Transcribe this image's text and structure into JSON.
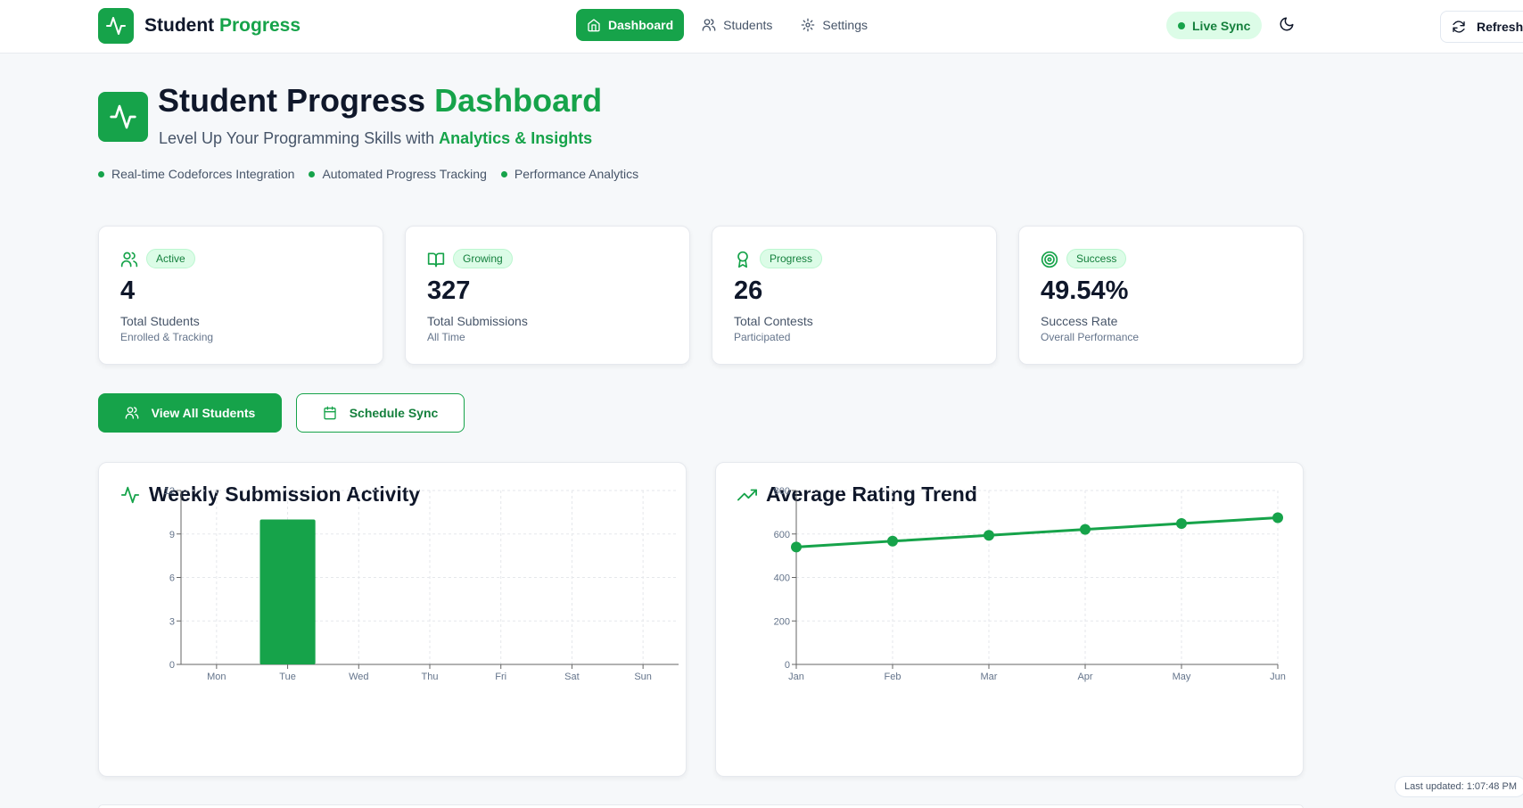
{
  "nav": {
    "brand_first": "Student",
    "brand_second": "Progress",
    "links": [
      {
        "label": "Dashboard",
        "icon": "home-icon",
        "active": true
      },
      {
        "label": "Students",
        "icon": "users-icon",
        "active": false
      },
      {
        "label": "Settings",
        "icon": "gear-icon",
        "active": false
      }
    ],
    "live_sync": "Live Sync",
    "refresh": "Refresh"
  },
  "hero": {
    "title_first": "Student Progress",
    "title_second": "Dashboard",
    "subtitle_first": "Level Up Your Programming Skills with",
    "subtitle_second": "Analytics & Insights",
    "features": [
      "Real-time Codeforces Integration",
      "Automated Progress Tracking",
      "Performance Analytics"
    ]
  },
  "stats": [
    {
      "badge": "Active",
      "value": "4",
      "label": "Total Students",
      "sub": "Enrolled & Tracking",
      "icon": "users-icon"
    },
    {
      "badge": "Growing",
      "value": "327",
      "label": "Total Submissions",
      "sub": "All Time",
      "icon": "book-icon"
    },
    {
      "badge": "Progress",
      "value": "26",
      "label": "Total Contests",
      "sub": "Participated",
      "icon": "award-icon"
    },
    {
      "badge": "Success",
      "value": "49.54%",
      "label": "Success Rate",
      "sub": "Overall Performance",
      "icon": "target-icon"
    }
  ],
  "actions": {
    "view_all": "View All Students",
    "schedule": "Schedule Sync"
  },
  "panels": {
    "weekly_title": "Weekly Submission Activity",
    "rating_title": "Average Rating Trend"
  },
  "last_updated": "Last updated: 1:07:48 PM",
  "colors": {
    "accent": "#16a34a",
    "accent_light": "#dcfce7"
  },
  "chart_data": [
    {
      "type": "bar",
      "title": "Weekly Submission Activity",
      "categories": [
        "Mon",
        "Tue",
        "Wed",
        "Thu",
        "Fri",
        "Sat",
        "Sun"
      ],
      "values": [
        0,
        10,
        0,
        0,
        0,
        0,
        0
      ],
      "ylim": [
        0,
        12
      ],
      "yticks": [
        0,
        3,
        6,
        9,
        12
      ],
      "grid": true
    },
    {
      "type": "line",
      "title": "Average Rating Trend",
      "categories": [
        "Jan",
        "Feb",
        "Mar",
        "Apr",
        "May",
        "Jun"
      ],
      "values": [
        540,
        567,
        594,
        621,
        648,
        675
      ],
      "ylim": [
        0,
        800
      ],
      "yticks": [
        0,
        200,
        400,
        600,
        800
      ],
      "grid": true
    }
  ]
}
